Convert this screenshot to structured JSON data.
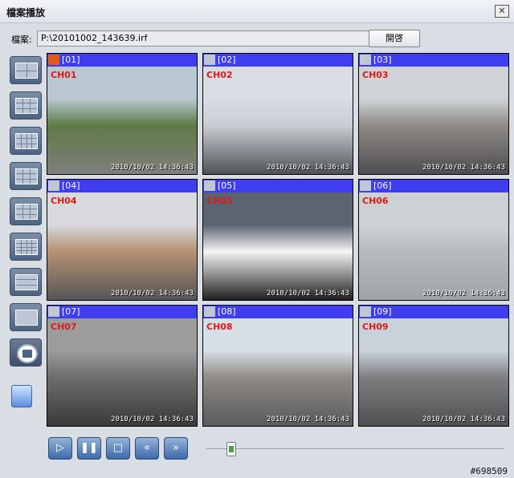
{
  "window": {
    "title": "檔案播放",
    "close_label": "✕"
  },
  "file": {
    "label": "檔案:",
    "path": "P:\\20101002_143639.irf",
    "open_label": "開啓"
  },
  "layout_buttons": [
    {
      "name": "layout-4-icon",
      "rows": 2,
      "cols": 2
    },
    {
      "name": "layout-6-icon",
      "rows": 3,
      "cols": 3
    },
    {
      "name": "layout-9-icon",
      "rows": 3,
      "cols": 4
    },
    {
      "name": "layout-10-icon",
      "rows": 3,
      "cols": 3
    },
    {
      "name": "layout-13-icon",
      "rows": 3,
      "cols": 3
    },
    {
      "name": "layout-16-icon",
      "rows": 4,
      "cols": 4
    },
    {
      "name": "layout-strip-icon",
      "rows": 3,
      "cols": 1
    },
    {
      "name": "layout-single-icon",
      "rows": 1,
      "cols": 1
    }
  ],
  "channels": [
    {
      "id": "[01]",
      "label": "CH01",
      "audio": "on",
      "time": "2010/10/02 14:36:43",
      "scene": [
        "#b9c7d2",
        "#5f7a45",
        "#7f7f7f"
      ]
    },
    {
      "id": "[02]",
      "label": "CH02",
      "audio": "off",
      "time": "2010/10/02 14:36:43",
      "scene": [
        "#d8dde3",
        "#c9cdd2",
        "#505257"
      ]
    },
    {
      "id": "[03]",
      "label": "CH03",
      "audio": "off",
      "time": "2010/10/02 14:36:43",
      "scene": [
        "#cfd3d6",
        "#8e8a86",
        "#4e4e50"
      ]
    },
    {
      "id": "[04]",
      "label": "CH04",
      "audio": "off",
      "time": "2010/10/02 14:36:43",
      "scene": [
        "#d7d9dc",
        "#b69170",
        "#555658"
      ]
    },
    {
      "id": "[05]",
      "label": "CH05",
      "audio": "off",
      "time": "2010/10/02 14:36:43",
      "scene": [
        "#5b6470",
        "#f4f4f4",
        "#1f1f1f"
      ]
    },
    {
      "id": "[06]",
      "label": "CH06",
      "audio": "off",
      "time": "2010/10/02 14:36:43",
      "scene": [
        "#cdd1d4",
        "#b7bbbf",
        "#9ea3a7"
      ]
    },
    {
      "id": "[07]",
      "label": "CH07",
      "audio": "off",
      "time": "2010/10/02 14:36:43",
      "scene": [
        "#9c9c9c",
        "#6d6d6d",
        "#3a3a3a"
      ]
    },
    {
      "id": "[08]",
      "label": "CH08",
      "audio": "off",
      "time": "2010/10/02 14:36:43",
      "scene": [
        "#d7dfe6",
        "#8f8a84",
        "#5a5b5d"
      ]
    },
    {
      "id": "[09]",
      "label": "CH09",
      "audio": "off",
      "time": "2010/10/02 14:36:43",
      "scene": [
        "#c9d2db",
        "#7d7e80",
        "#4f5052"
      ]
    }
  ],
  "playback": {
    "buttons": [
      {
        "name": "play-button",
        "glyph": "▷"
      },
      {
        "name": "pause-button",
        "glyph": "❚❚"
      },
      {
        "name": "stop-button",
        "glyph": "□"
      },
      {
        "name": "rewind-button",
        "glyph": "«"
      },
      {
        "name": "fast-forward-button",
        "glyph": "»"
      }
    ],
    "position_fraction": 0.07
  },
  "watermark": "#698509",
  "colors": {
    "channel_header": "#3e3ef0",
    "channel_label": "#e01818"
  }
}
